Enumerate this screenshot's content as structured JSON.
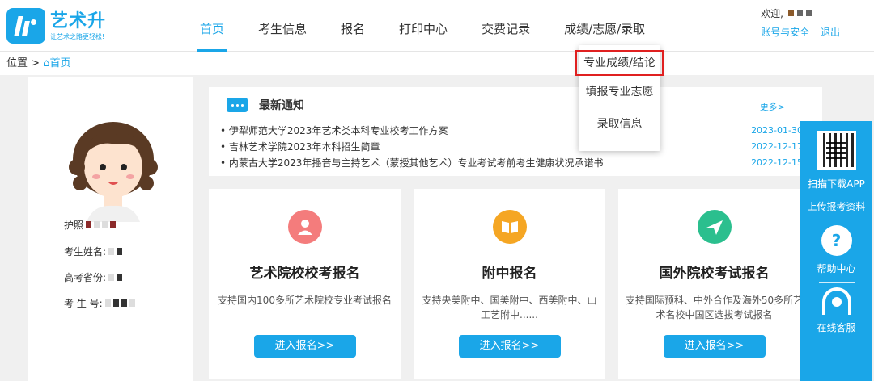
{
  "brand": {
    "name": "艺术升",
    "slogan": "让艺术之路更轻松!"
  },
  "nav": {
    "items": [
      {
        "label": "首页",
        "active": true
      },
      {
        "label": "考生信息"
      },
      {
        "label": "报名"
      },
      {
        "label": "打印中心"
      },
      {
        "label": "交费记录"
      },
      {
        "label": "成绩/志愿/录取"
      }
    ]
  },
  "user": {
    "welcome": "欢迎,",
    "account_link": "账号与安全",
    "logout_link": "退出"
  },
  "breadcrumb": {
    "prefix": "位置 >",
    "home": "首页"
  },
  "dropdown": {
    "items": [
      "专业成绩/结论",
      "填报专业志愿",
      "录取信息"
    ]
  },
  "profile": {
    "passport_label": "护照",
    "name_label": "考生姓名:",
    "province_label": "高考省份:",
    "id_label": "考 生 号:"
  },
  "notices": {
    "title": "最新通知",
    "more": "更多>",
    "items": [
      {
        "text": "伊犁师范大学2023年艺术类本科专业校考工作方案",
        "date": "2023-01-30"
      },
      {
        "text": "吉林艺术学院2023年本科招生简章",
        "date": "2022-12-17"
      },
      {
        "text": "内蒙古大学2023年播音与主持艺术（蒙授其他艺术）专业考试考前考生健康状况承诺书",
        "date": "2022-12-15"
      }
    ]
  },
  "cards": [
    {
      "title": "艺术院校校考报名",
      "desc": "支持国内100多所艺术院校专业考试报名",
      "button": "进入报名>>",
      "color": "#f47c7c"
    },
    {
      "title": "附中报名",
      "desc": "支持央美附中、国美附中、西美附中、山工艺附中......",
      "button": "进入报名>>",
      "color": "#f5a623"
    },
    {
      "title": "国外院校考试报名",
      "desc": "支持国际预科、中外合作及海外50多所艺术名校中国区选拔考试报名",
      "button": "进入报名>>",
      "color": "#2bbf8e"
    }
  ],
  "side": {
    "scan_text": "扫描下载APP",
    "upload_text": "上传报考资料",
    "help_text": "帮助中心",
    "service_text": "在线客服"
  }
}
